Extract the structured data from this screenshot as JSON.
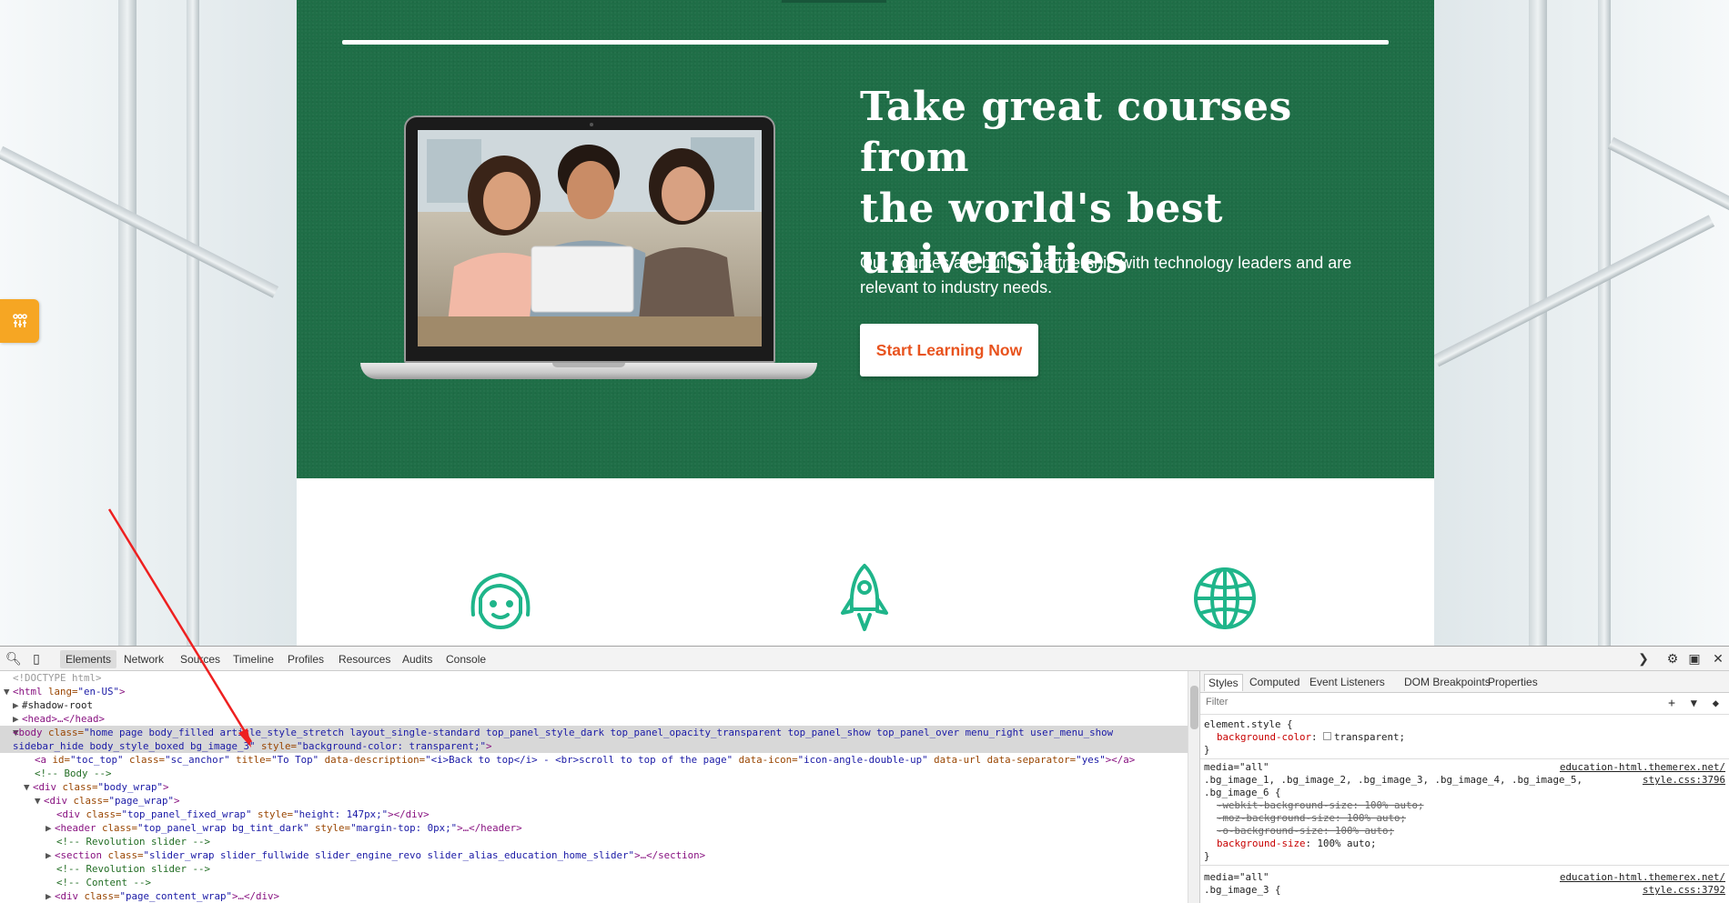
{
  "hero": {
    "title_line1": "Take great courses from",
    "title_line2": "the world's best",
    "title_line3": "universities",
    "subtitle_line1": "Our courses are built in partnership with technology leaders and are",
    "subtitle_line2": "relevant to industry needs.",
    "cta_label": "Start Learning Now",
    "bg_color": "#1f6e47",
    "cta_color": "#e8531e"
  },
  "features": {
    "icons": [
      "girl-face-icon",
      "rocket-icon",
      "globe-icon"
    ],
    "icon_color": "#1fb58a"
  },
  "side_tab": {
    "icon": "settings-grid-icon",
    "color": "#f6a623"
  },
  "devtools": {
    "tabs": [
      "Elements",
      "Network",
      "Sources",
      "Timeline",
      "Profiles",
      "Resources",
      "Audits",
      "Console"
    ],
    "active_tab": "Elements",
    "code": {
      "l1": "<!DOCTYPE html>",
      "l2_tag": "<html",
      "l2_attr": " lang=",
      "l2_val": "\"en-US\"",
      "l2_end": ">",
      "l3": "#shadow-root",
      "l4": "<head>…</head>",
      "l5_tag": "<body",
      "l5_attr": " class=",
      "l5_val": "\"home page body_filled article_style_stretch layout_single-standard top_panel_style_dark top_panel_opacity_transparent top_panel_show top_panel_over menu_right user_menu_show",
      "l6_val": "sidebar_hide body_style_boxed bg_image_3\"",
      "l6_attr": " style=",
      "l6_val2": "\"background-color: transparent;\"",
      "l6_end": ">",
      "l7_a": "<a",
      "l7_rest_attr1": " id=",
      "l7_rest_val1": "\"toc_top\"",
      "l7_rest_attr2": " class=",
      "l7_rest_val2": "\"sc_anchor\"",
      "l7_rest_attr3": " title=",
      "l7_rest_val3": "\"To Top\"",
      "l7_rest_attr4": " data-description=",
      "l7_rest_val4": "\"<i>Back to top</i> - <br>scroll to top of the page\"",
      "l7_rest_attr5": " data-icon=",
      "l7_rest_val5": "\"icon-angle-double-up\"",
      "l7_rest_attr6": " data-url data-separator=",
      "l7_rest_val6": "\"yes\"",
      "l7_end": "></a>",
      "l8": "<!-- Body -->",
      "l9_tag": "<div",
      "l9_attr": " class=",
      "l9_val": "\"body_wrap\"",
      "l9_end": ">",
      "l10_tag": "<div",
      "l10_attr": " class=",
      "l10_val": "\"page_wrap\"",
      "l10_end": ">",
      "l11_tag": "<div",
      "l11_attr": " class=",
      "l11_val": "\"top_panel_fixed_wrap\"",
      "l11_attr2": " style=",
      "l11_val2": "\"height: 147px;\"",
      "l11_end": "></div>",
      "l12_tag": "<header",
      "l12_attr": " class=",
      "l12_val": "\"top_panel_wrap bg_tint_dark\"",
      "l12_attr2": " style=",
      "l12_val2": "\"margin-top: 0px;\"",
      "l12_end": ">…</header>",
      "l13": "<!-- Revolution slider -->",
      "l14_tag": "<section",
      "l14_attr": " class=",
      "l14_val": "\"slider_wrap slider_fullwide slider_engine_revo slider_alias_education_home_slider\"",
      "l14_end": ">…</section>",
      "l15": "<!-- Revolution slider -->",
      "l16": "<!-- Content -->",
      "l17_tag": "<div",
      "l17_attr": " class=",
      "l17_val": "\"page_content_wrap\"",
      "l17_end": ">…</div>"
    },
    "styles": {
      "tabs": [
        "Styles",
        "Computed",
        "Event Listeners",
        "DOM Breakpoints",
        "Properties"
      ],
      "filter_placeholder": "Filter",
      "r1_selector": "element.style {",
      "r1_prop": "background-color",
      "r1_val": "transparent;",
      "close": "}",
      "r2_media": "media=\"all\"",
      "r2_link": "education-html.themerex.net/",
      "r2_selector": ".bg_image_1, .bg_image_2, .bg_image_3, .bg_image_4, .bg_image_5,",
      "r2_file": "style.css:3796",
      "r2_selector2": ".bg_image_6 {",
      "r2_s1": "-webkit-background-size: 100% auto;",
      "r2_s2": "-moz-background-size: 100% auto;",
      "r2_s3": "-o-background-size: 100% auto;",
      "r2_prop": "background-size",
      "r2_val": "100% auto;",
      "r3_media": "media=\"all\"",
      "r3_link": "education-html.themerex.net/",
      "r3_selector": ".bg_image_3 {",
      "r3_file": "style.css:3792"
    }
  }
}
